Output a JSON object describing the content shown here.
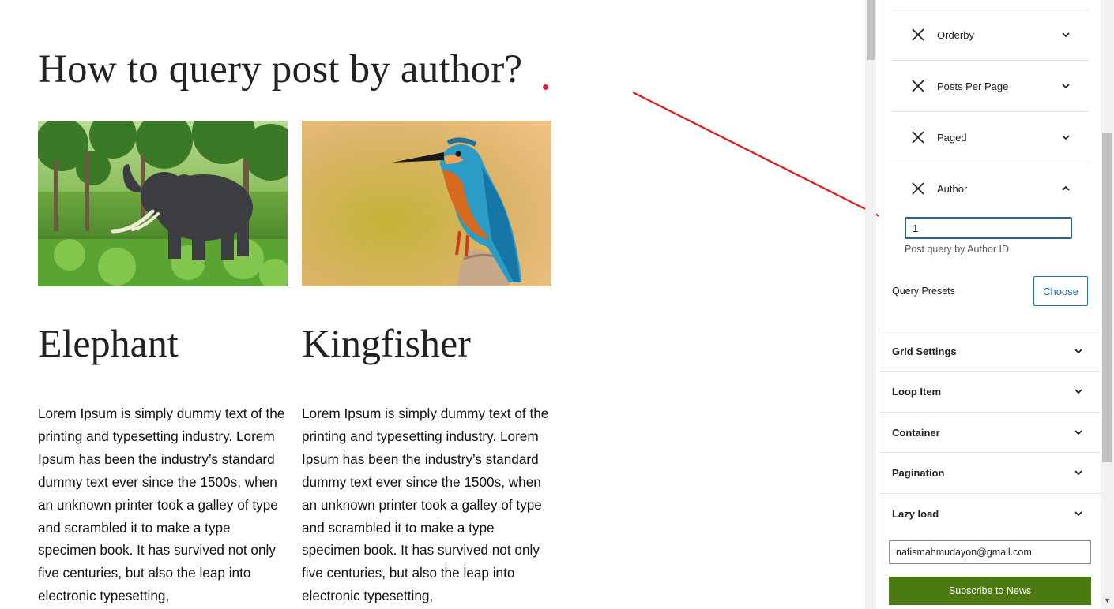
{
  "post": {
    "title": "How to query post by author?",
    "cards": [
      {
        "title": "Elephant",
        "image_icon": "elephant-photo",
        "excerpt": "Lorem Ipsum is simply dummy text of the printing and typesetting industry. Lorem Ipsum has been the industry’s standard dummy text ever since the 1500s, when an unknown printer took a galley of type and scrambled it to make a type specimen book. It has survived not only five centuries, but also the leap into electronic typesetting,"
      },
      {
        "title": "Kingfisher",
        "image_icon": "kingfisher-photo",
        "excerpt": "Lorem Ipsum is simply dummy text of the printing and typesetting industry. Lorem Ipsum has been the industry’s standard dummy text ever since the 1500s, when an unknown printer took a galley of type and scrambled it to make a type specimen book. It has survived not only five centuries, but also the leap into electronic typesetting,"
      }
    ]
  },
  "sidebar": {
    "query_params": [
      {
        "label": "Orderby",
        "expanded": false
      },
      {
        "label": "Posts Per Page",
        "expanded": false
      },
      {
        "label": "Paged",
        "expanded": false
      },
      {
        "label": "Author",
        "expanded": true
      }
    ],
    "author": {
      "value": "1",
      "help": "Post query by Author ID"
    },
    "presets": {
      "label": "Query Presets",
      "button": "Choose"
    },
    "panels": [
      {
        "label": "Grid Settings"
      },
      {
        "label": "Loop Item"
      },
      {
        "label": "Container"
      },
      {
        "label": "Pagination"
      },
      {
        "label": "Lazy load"
      }
    ],
    "newsletter": {
      "email": "nafismahmudayon@gmail.com",
      "button": "Subscribe to News"
    }
  },
  "colors": {
    "accent": "#2271b1",
    "annotation_arrow": "#e0191c",
    "dot": "#dd1e3e",
    "subscribe": "#4b7a12"
  }
}
